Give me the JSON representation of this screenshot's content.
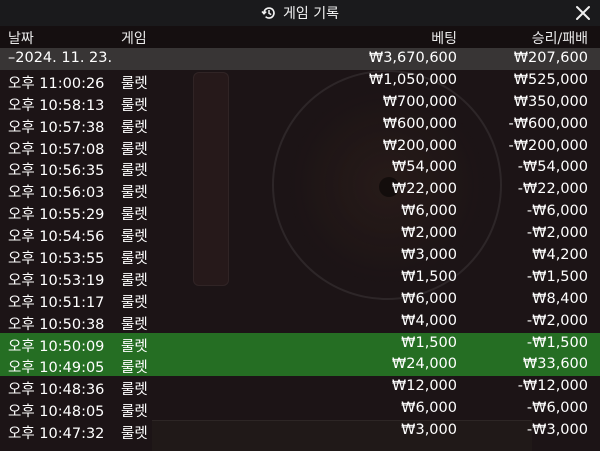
{
  "dialog": {
    "title": "게임 기록",
    "icon": "history-clock-icon",
    "close_icon": "close-icon"
  },
  "columns": {
    "date": "날짜",
    "game": "게임",
    "bet": "베팅",
    "result": "승리/패배"
  },
  "summary": {
    "date": "–2024. 11. 23.",
    "bet": "₩3,670,600",
    "result": "₩207,600"
  },
  "rows": [
    {
      "time": "오후 11:00:26",
      "game": "룰렛",
      "bet": "₩1,050,000",
      "result": "₩525,000"
    },
    {
      "time": "오후 10:58:13",
      "game": "룰렛",
      "bet": "₩700,000",
      "result": "₩350,000"
    },
    {
      "time": "오후 10:57:38",
      "game": "룰렛",
      "bet": "₩600,000",
      "result": "-₩600,000"
    },
    {
      "time": "오후 10:57:08",
      "game": "룰렛",
      "bet": "₩200,000",
      "result": "-₩200,000"
    },
    {
      "time": "오후 10:56:35",
      "game": "룰렛",
      "bet": "₩54,000",
      "result": "-₩54,000"
    },
    {
      "time": "오후 10:56:03",
      "game": "룰렛",
      "bet": "₩22,000",
      "result": "-₩22,000"
    },
    {
      "time": "오후 10:55:29",
      "game": "룰렛",
      "bet": "₩6,000",
      "result": "-₩6,000"
    },
    {
      "time": "오후 10:54:56",
      "game": "룰렛",
      "bet": "₩2,000",
      "result": "-₩2,000"
    },
    {
      "time": "오후 10:53:55",
      "game": "룰렛",
      "bet": "₩3,000",
      "result": "₩4,200"
    },
    {
      "time": "오후 10:53:19",
      "game": "룰렛",
      "bet": "₩1,500",
      "result": "-₩1,500"
    },
    {
      "time": "오후 10:51:17",
      "game": "룰렛",
      "bet": "₩6,000",
      "result": "₩8,400"
    },
    {
      "time": "오후 10:50:38",
      "game": "룰렛",
      "bet": "₩4,000",
      "result": "-₩2,000"
    },
    {
      "time": "오후 10:50:09",
      "game": "룰렛",
      "bet": "₩1,500",
      "result": "-₩1,500"
    },
    {
      "time": "오후 10:49:05",
      "game": "룰렛",
      "bet": "₩24,000",
      "result": "₩33,600"
    },
    {
      "time": "오후 10:48:36",
      "game": "룰렛",
      "bet": "₩12,000",
      "result": "-₩12,000"
    },
    {
      "time": "오후 10:48:05",
      "game": "룰렛",
      "bet": "₩6,000",
      "result": "-₩6,000"
    },
    {
      "time": "오후 10:47:32",
      "game": "룰렛",
      "bet": "₩3,000",
      "result": "-₩3,000"
    }
  ],
  "highlighted_rows": [
    12,
    13
  ],
  "colors": {
    "highlight": "#2a8c2a",
    "summary": "#505050",
    "titlebar": "#1a1a1c"
  }
}
